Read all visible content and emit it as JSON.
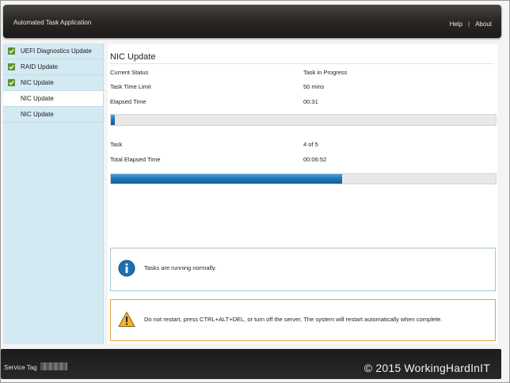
{
  "window": {
    "app_title": "Automated Task Application",
    "help_link": "Help",
    "separator": "|",
    "about_link": "About"
  },
  "sidebar": {
    "items": [
      {
        "label": "UEFI Diagnostics Update",
        "completed": true
      },
      {
        "label": "RAID Update",
        "completed": true
      },
      {
        "label": "NIC Update",
        "completed": true
      },
      {
        "label": "NIC Update",
        "completed": false,
        "selected": true
      },
      {
        "label": "NIC Update",
        "completed": false
      }
    ]
  },
  "main": {
    "title": "NIC Update",
    "current_status_label": "Current Status",
    "current_status_value": "Task in Progress",
    "time_limit_label": "Task Time Limit",
    "time_limit_value": "50 mins",
    "elapsed_label": "Elapsed Time",
    "elapsed_value": "00:31",
    "task_progress_fraction": 0.01,
    "task_label": "Task",
    "task_value": "4 of 5",
    "total_elapsed_label": "Total Elapsed Time",
    "total_elapsed_value": "00:06:52",
    "overall_progress_fraction": 0.6,
    "info_message": "Tasks are running normally.",
    "warning_message": "Do not restart, press CTRL+ALT+DEL, or turn off the server.  The system will restart automatically when complete."
  },
  "footer": {
    "service_tag_label": "Service Tag",
    "watermark": "© 2015 WorkingHardInIT"
  },
  "colors": {
    "accent_blue": "#1b75b6",
    "check_green": "#5f8f2e",
    "warning_orange": "#e0a53b",
    "sidebar_bg": "#d3eaf3"
  },
  "icons": {
    "check": "checkmark-icon",
    "info": "info-icon",
    "warning": "warning-triangle-icon"
  }
}
